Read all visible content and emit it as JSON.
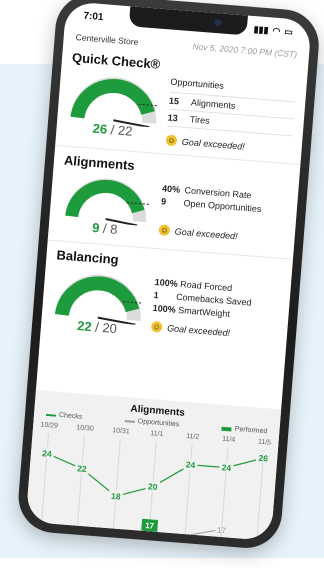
{
  "status_bar": {
    "time": "7:01",
    "signal_icon": "signal-bars-icon",
    "wifi_icon": "wifi-icon",
    "battery_icon": "battery-icon"
  },
  "header": {
    "store": "Centerville Store",
    "date": "Nov 5, 2020 7:00 PM (CST)"
  },
  "quick_check": {
    "title": "Quick Check®",
    "value": "26",
    "target": "/ 22",
    "fraction": 0.95,
    "stats_head": "Opportunities",
    "stats": [
      {
        "num": "15",
        "label": "Alignments"
      },
      {
        "num": "13",
        "label": "Tires"
      }
    ],
    "goal": "Goal exceeded!"
  },
  "alignments": {
    "title": "Alignments",
    "value": "9",
    "target": "/ 8",
    "fraction": 0.92,
    "stats": [
      {
        "num": "40%",
        "label": "Conversion Rate"
      },
      {
        "num": "9",
        "label": "Open Opportunities"
      }
    ],
    "goal": "Goal exceeded!"
  },
  "balancing": {
    "title": "Balancing",
    "value": "22",
    "target": "/ 20",
    "fraction": 0.93,
    "stats": [
      {
        "num": "100%",
        "label": "Road Forced"
      },
      {
        "num": "1",
        "label": "Comebacks Saved"
      },
      {
        "num": "100%",
        "label": "SmartWeight"
      }
    ],
    "goal": "Goal exceeded!"
  },
  "chart": {
    "title": "Alignments",
    "legend": [
      "Checks",
      "Opportunities",
      "Performed"
    ],
    "dates": [
      "10/29",
      "10/30",
      "10/31",
      "11/1",
      "11/2",
      "11/4",
      "11/5"
    ],
    "checks": [
      24,
      22,
      18,
      20,
      24,
      24,
      26
    ],
    "performed_highlight": "17",
    "opportunities_label": "17",
    "colors": {
      "green": "#1e9b3c",
      "gray": "#9a9a9a"
    }
  }
}
